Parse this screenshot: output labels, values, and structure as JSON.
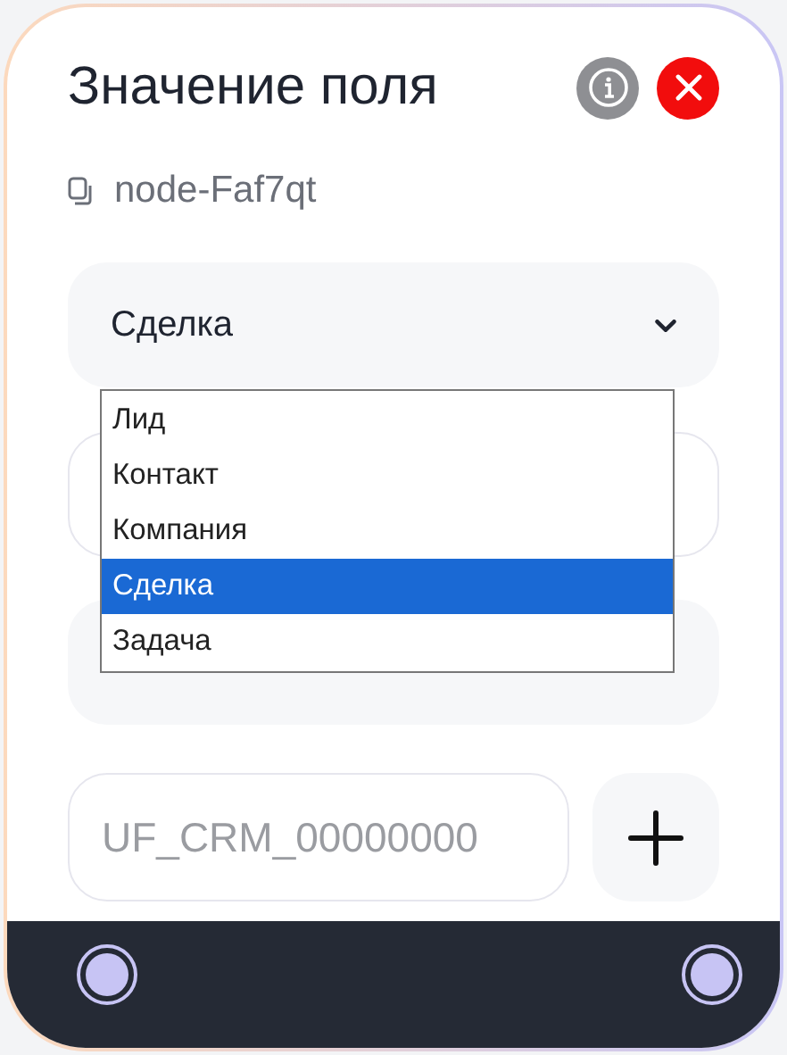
{
  "title": "Значение поля",
  "node_id": "node-Faf7qt",
  "entity_select": {
    "value": "Сделка",
    "expanded": true,
    "options": [
      {
        "label": "Лид",
        "selected": false
      },
      {
        "label": "Контакт",
        "selected": false
      },
      {
        "label": "Компания",
        "selected": false
      },
      {
        "label": "Сделка",
        "selected": true
      },
      {
        "label": "Задача",
        "selected": false
      }
    ]
  },
  "code_input": {
    "placeholder": "UF_CRM_00000000"
  }
}
